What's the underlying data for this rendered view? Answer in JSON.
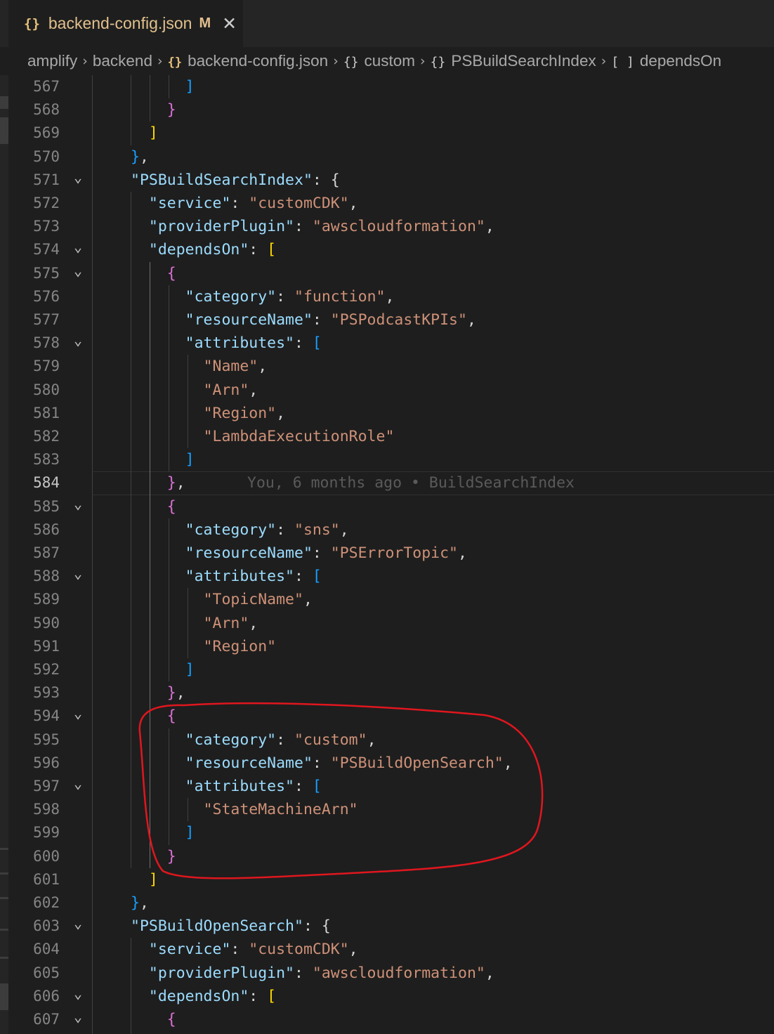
{
  "tab": {
    "icon": "json-braces-icon",
    "filename": "backend-config.json",
    "status": "M",
    "close_icon": "close-icon"
  },
  "breadcrumb": [
    {
      "label": "amplify",
      "icon": ""
    },
    {
      "label": "backend",
      "icon": ""
    },
    {
      "label": "backend-config.json",
      "icon": "{}"
    },
    {
      "label": "custom",
      "icon": "{}"
    },
    {
      "label": "PSBuildSearchIndex",
      "icon": "{}"
    },
    {
      "label": "dependsOn",
      "icon": "[ ]"
    }
  ],
  "editor": {
    "current_line": 584,
    "blame": "You, 6 months ago • BuildSearchIndex",
    "lines": [
      {
        "n": 567,
        "text": "      ]"
      },
      {
        "n": 568,
        "text": "    }"
      },
      {
        "n": 569,
        "text": "  ]"
      },
      {
        "n": 570,
        "text": "},"
      },
      {
        "n": 571,
        "text": "\"PSBuildSearchIndex\": {",
        "fold": true
      },
      {
        "n": 572,
        "text": "  \"service\": \"customCDK\","
      },
      {
        "n": 573,
        "text": "  \"providerPlugin\": \"awscloudformation\","
      },
      {
        "n": 574,
        "text": "  \"dependsOn\": [",
        "fold": true
      },
      {
        "n": 575,
        "text": "    {",
        "fold": true
      },
      {
        "n": 576,
        "text": "      \"category\": \"function\","
      },
      {
        "n": 577,
        "text": "      \"resourceName\": \"PSPodcastKPIs\","
      },
      {
        "n": 578,
        "text": "      \"attributes\": [",
        "fold": true
      },
      {
        "n": 579,
        "text": "        \"Name\","
      },
      {
        "n": 580,
        "text": "        \"Arn\","
      },
      {
        "n": 581,
        "text": "        \"Region\","
      },
      {
        "n": 582,
        "text": "        \"LambdaExecutionRole\""
      },
      {
        "n": 583,
        "text": "      ]"
      },
      {
        "n": 584,
        "text": "    },"
      },
      {
        "n": 585,
        "text": "    {",
        "fold": true
      },
      {
        "n": 586,
        "text": "      \"category\": \"sns\","
      },
      {
        "n": 587,
        "text": "      \"resourceName\": \"PSErrorTopic\","
      },
      {
        "n": 588,
        "text": "      \"attributes\": [",
        "fold": true
      },
      {
        "n": 589,
        "text": "        \"TopicName\","
      },
      {
        "n": 590,
        "text": "        \"Arn\","
      },
      {
        "n": 591,
        "text": "        \"Region\""
      },
      {
        "n": 592,
        "text": "      ]"
      },
      {
        "n": 593,
        "text": "    },"
      },
      {
        "n": 594,
        "text": "    {",
        "fold": true
      },
      {
        "n": 595,
        "text": "      \"category\": \"custom\","
      },
      {
        "n": 596,
        "text": "      \"resourceName\": \"PSBuildOpenSearch\","
      },
      {
        "n": 597,
        "text": "      \"attributes\": [",
        "fold": true
      },
      {
        "n": 598,
        "text": "        \"StateMachineArn\""
      },
      {
        "n": 599,
        "text": "      ]"
      },
      {
        "n": 600,
        "text": "    }"
      },
      {
        "n": 601,
        "text": "  ]"
      },
      {
        "n": 602,
        "text": "},"
      },
      {
        "n": 603,
        "text": "\"PSBuildOpenSearch\": {",
        "fold": true
      },
      {
        "n": 604,
        "text": "  \"service\": \"customCDK\","
      },
      {
        "n": 605,
        "text": "  \"providerPlugin\": \"awscloudformation\","
      },
      {
        "n": 606,
        "text": "  \"dependsOn\": [",
        "fold": true
      },
      {
        "n": 607,
        "text": "    {",
        "fold": true
      }
    ]
  },
  "colors": {
    "key": "#9cdcfe",
    "string": "#ce9178",
    "bracket_level1": "#ffd700",
    "bracket_level2": "#da70d6",
    "bracket_level3": "#179fff",
    "annotation": "#e0161e"
  }
}
